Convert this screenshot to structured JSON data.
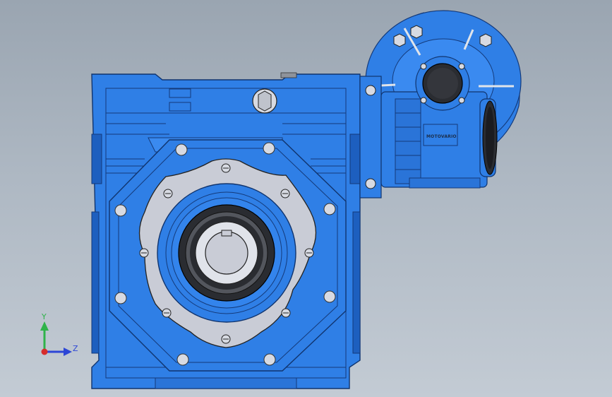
{
  "viewport": {
    "background_top": "#9aa5b1",
    "background_bottom": "#c3cbd4"
  },
  "model": {
    "housing_color": "#2f7fe6",
    "housing_shade": "#1d5fbf",
    "flange_color": "#c9ccd6",
    "bore_color": "#c9ccd6",
    "seal_color": "#2a2c31",
    "input_plate": {
      "brand_text": "MOTOVARIO"
    }
  },
  "triad": {
    "y_label": "Y",
    "z_label": "Z",
    "y_color": "#2fb34a",
    "z_color": "#2c46d6",
    "x_color": "#d62c2c"
  }
}
